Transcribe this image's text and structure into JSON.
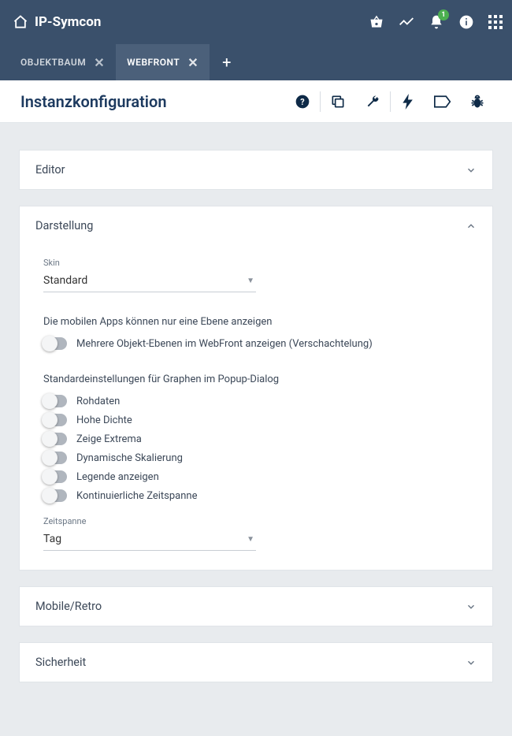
{
  "header": {
    "title": "IP-Symcon",
    "notification_count": "1"
  },
  "tabs": {
    "items": [
      {
        "label": "OBJEKTBAUM",
        "active": false
      },
      {
        "label": "WEBFRONT",
        "active": true
      }
    ]
  },
  "page": {
    "title": "Instanzkonfiguration"
  },
  "sections": {
    "editor": {
      "title": "Editor"
    },
    "darstellung": {
      "title": "Darstellung",
      "skin_label": "Skin",
      "skin_value": "Standard",
      "mobile_hint": "Die mobilen Apps können nur eine Ebene anzeigen",
      "nesting_label": "Mehrere Objekt-Ebenen im WebFront anzeigen (Verschachtelung)",
      "graph_hint": "Standardeinstellungen für Graphen im Popup-Dialog",
      "toggles": {
        "rohdaten": "Rohdaten",
        "hohedichte": "Hohe Dichte",
        "extrema": "Zeige Extrema",
        "dynskal": "Dynamische Skalierung",
        "legende": "Legende anzeigen",
        "kontzeit": "Kontinuierliche Zeitspanne"
      },
      "zeitspanne_label": "Zeitspanne",
      "zeitspanne_value": "Tag"
    },
    "mobileretro": {
      "title": "Mobile/Retro"
    },
    "sicherheit": {
      "title": "Sicherheit"
    }
  }
}
